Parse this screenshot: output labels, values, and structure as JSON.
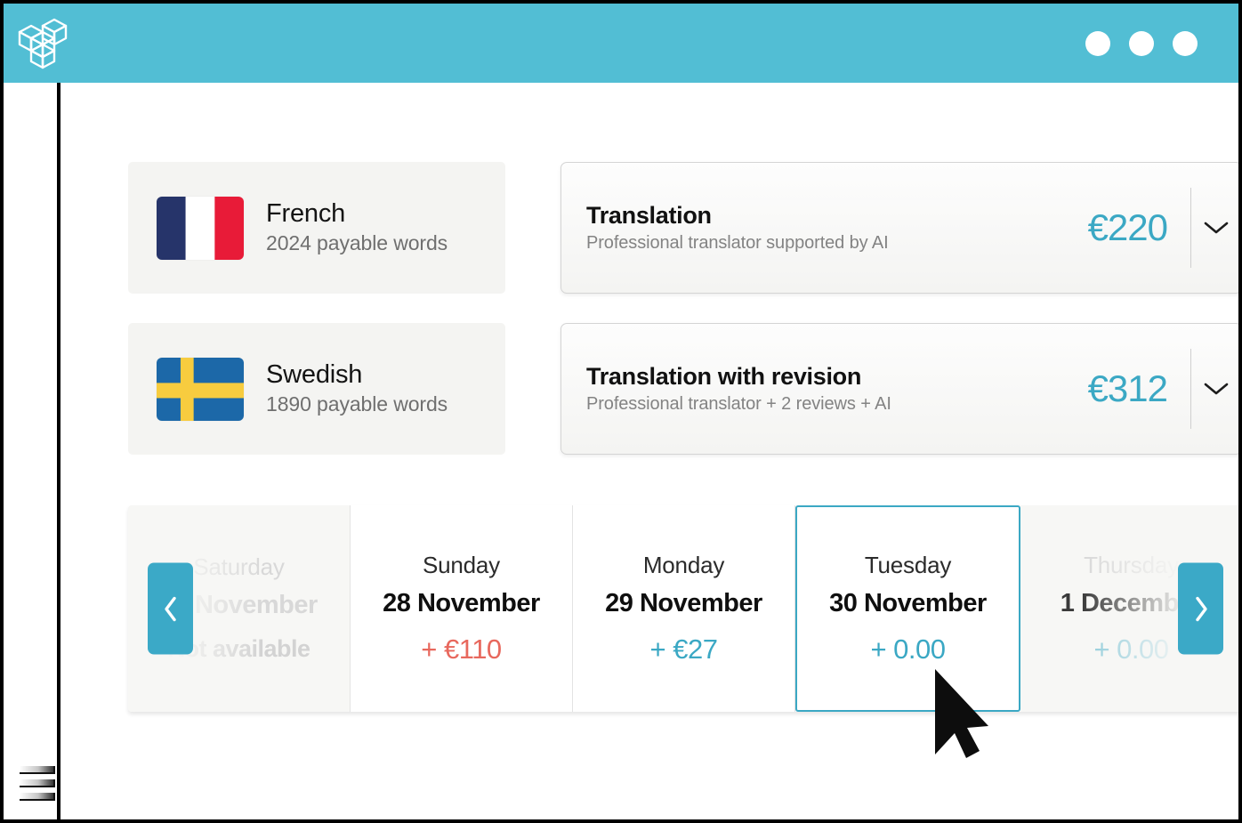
{
  "titlebar": {
    "logo_name": "isometric-cubes-logo",
    "window_dots": [
      "dot-1",
      "dot-2",
      "dot-3"
    ]
  },
  "sidebar": {
    "menu_icon": "stacked-bars-icon"
  },
  "quote_rows": [
    {
      "language": {
        "name": "French",
        "words": "2024 payable words",
        "flag": "flag-france"
      },
      "service": {
        "title": "Translation",
        "subtitle": "Professional translator supported by AI",
        "price": "€220",
        "expand_icon": "chevron-down-icon"
      }
    },
    {
      "language": {
        "name": "Swedish",
        "words": "1890 payable words",
        "flag": "flag-sweden"
      },
      "service": {
        "title": "Translation with revision",
        "subtitle": "Professional translator + 2 reviews + AI",
        "price": "€312",
        "expand_icon": "chevron-down-icon"
      }
    }
  ],
  "delivery_picker": {
    "prev_label": "‹",
    "next_label": "›",
    "days": [
      {
        "weekday": "Saturday",
        "date": "27 November",
        "price": "Not available",
        "state": "unavailable",
        "price_style": "na"
      },
      {
        "weekday": "Sunday",
        "date": "28 November",
        "price": "+ €110",
        "state": "available",
        "price_style": "red"
      },
      {
        "weekday": "Monday",
        "date": "29 November",
        "price": "+ €27",
        "state": "available",
        "price_style": "teal"
      },
      {
        "weekday": "Tuesday",
        "date": "30 November",
        "price": "+ 0.00",
        "state": "selected",
        "price_style": "teal"
      },
      {
        "weekday": "Thursday",
        "date": "1 December",
        "price": "+ 0.00",
        "state": "partial",
        "price_style": "teal"
      }
    ]
  },
  "colors": {
    "brand_teal": "#52bed4",
    "accent_teal": "#3ba8c4",
    "nav_teal": "#3ba9c7",
    "surcharge_red": "#e8685d",
    "card_grey": "#f4f4f2",
    "muted_text": "#d8d8d8"
  },
  "cursor": {
    "name": "mouse-pointer"
  }
}
